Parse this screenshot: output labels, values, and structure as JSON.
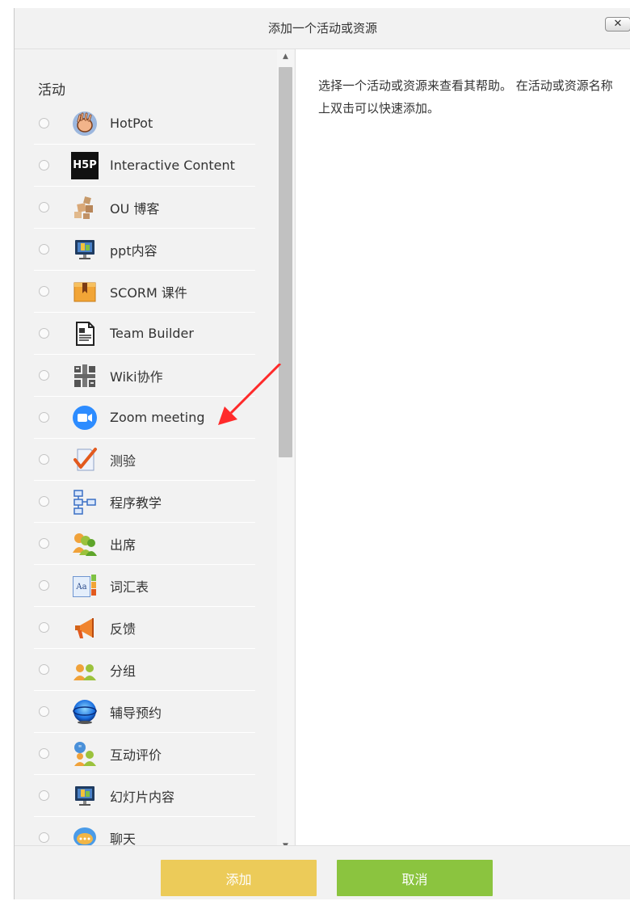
{
  "dialog": {
    "title": "添加一个活动或资源",
    "close_label": "✕",
    "section_label": "活动",
    "help_text": "选择一个活动或资源来查看其帮助。 在活动或资源名称上双击可以快速添加。",
    "colors": {
      "add_button": "#eccb59",
      "cancel_button": "#8bc43f",
      "annotation_arrow": "#ff2a2a",
      "zoom_blue": "#2d8cff"
    }
  },
  "options": [
    {
      "label": "HotPot",
      "icon": "hotpot-hand-icon"
    },
    {
      "label": "Interactive Content",
      "icon": "h5p-icon",
      "icon_text": "H5P"
    },
    {
      "label": "OU 博客",
      "icon": "ou-blog-icon"
    },
    {
      "label": "ppt内容",
      "icon": "ppt-monitor-icon"
    },
    {
      "label": "SCORM 课件",
      "icon": "scorm-package-icon"
    },
    {
      "label": "Team Builder",
      "icon": "team-builder-document-icon"
    },
    {
      "label": "Wiki协作",
      "icon": "wiki-blocks-icon"
    },
    {
      "label": "Zoom meeting",
      "icon": "zoom-camera-icon"
    },
    {
      "label": "测验",
      "icon": "quiz-checkmark-icon"
    },
    {
      "label": "程序教学",
      "icon": "lesson-flowchart-icon"
    },
    {
      "label": "出席",
      "icon": "attendance-people-icon"
    },
    {
      "label": "词汇表",
      "icon": "glossary-book-icon",
      "icon_text": "Aa"
    },
    {
      "label": "反馈",
      "icon": "feedback-megaphone-icon"
    },
    {
      "label": "分组",
      "icon": "group-people-icon"
    },
    {
      "label": "辅导预约",
      "icon": "scheduler-globe-icon"
    },
    {
      "label": "互动评价",
      "icon": "peer-review-icon"
    },
    {
      "label": "幻灯片内容",
      "icon": "slides-monitor-icon"
    },
    {
      "label": "聊天",
      "icon": "chat-bubble-icon"
    }
  ],
  "footer": {
    "add_label": "添加",
    "cancel_label": "取消"
  }
}
